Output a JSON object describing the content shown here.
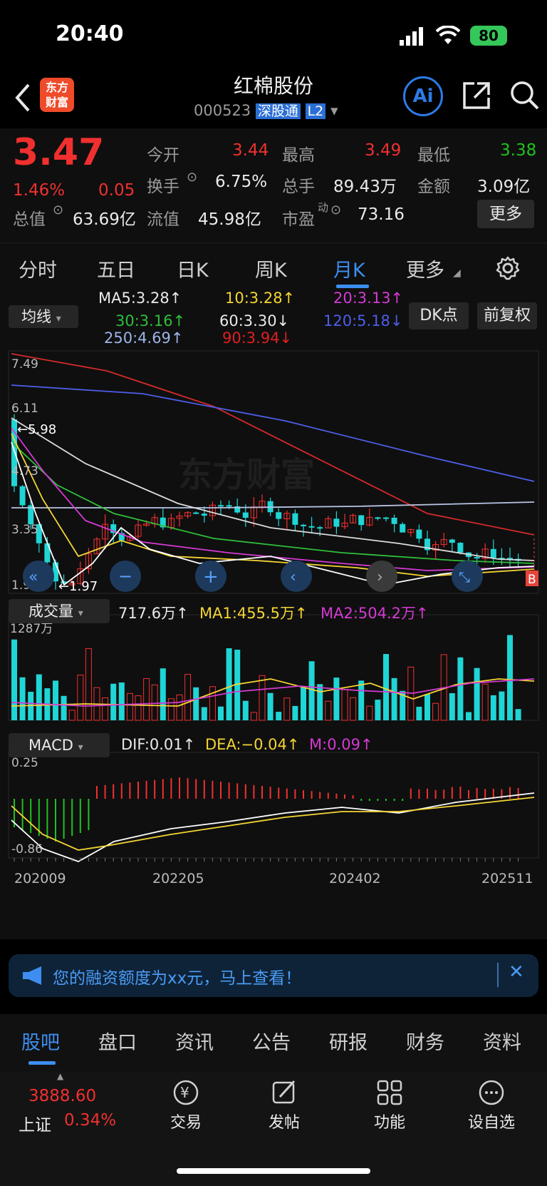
{
  "status_bar": {
    "time": "20:40",
    "battery": "80"
  },
  "header": {
    "title": "红棉股份",
    "code": "000523",
    "badge_market": "深股通",
    "badge_level": "L2",
    "ai_label": "Ai"
  },
  "quote": {
    "price": "3.47",
    "change_pct": "1.46%",
    "change": "0.05",
    "open_label": "今开",
    "open": "3.44",
    "high_label": "最高",
    "high": "3.49",
    "low_label": "最低",
    "low": "3.38",
    "turnover_label": "换手",
    "turnover": "6.75%",
    "volume_label": "总手",
    "volume": "89.43万",
    "amount_label": "金额",
    "amount": "3.09亿",
    "mcap_label": "总值",
    "mcap": "63.69亿",
    "float_label": "流值",
    "float": "45.98亿",
    "pe_label": "市盈",
    "pe_sup": "动",
    "pe": "73.16",
    "more_button": "更多"
  },
  "tabs": [
    "分时",
    "五日",
    "日K",
    "周K",
    "月K",
    "更多"
  ],
  "active_tab": "月K",
  "indicators": {
    "ma_selector": "均线",
    "ma5": "MA5:3.28↑",
    "ma10": "10:3.28↑",
    "ma20": "20:3.13↑",
    "ma30": "30:3.16↑",
    "ma60": "60:3.30↓",
    "ma120": "120:5.18↓",
    "ma250": "250:4.69↑",
    "ma90": "90:3.94↓",
    "dk_button": "DK点",
    "adjust_button": "前复权"
  },
  "kline": {
    "y_labels": [
      "7.49",
      "6.11",
      "4.73",
      "3.35",
      "1.97"
    ],
    "high_mark": "←5.98",
    "low_mark": "←1.97",
    "b_marker": "B",
    "watermark": "东方财富"
  },
  "volume": {
    "selector": "成交量",
    "value": "717.6万↑",
    "ma1": "MA1:455.5万↑",
    "ma2": "MA2:504.2万↑",
    "y_label": "1287万"
  },
  "macd": {
    "selector": "MACD",
    "dif": "DIF:0.01↑",
    "dea": "DEA:−0.04↑",
    "m": "M:0.09↑",
    "y_top": "0.25",
    "y_bottom": "-0.86"
  },
  "x_axis": [
    "202009",
    "202205",
    "202402",
    "202511"
  ],
  "banner": {
    "text": "您的融资额度为xx元，马上查看！"
  },
  "bottom_tabs": [
    "股吧",
    "盘口",
    "资讯",
    "公告",
    "研报",
    "财务",
    "资料"
  ],
  "bottom_tab_active": "股吧",
  "bottom_bar": {
    "index_value": "3888.60",
    "index_name": "上证",
    "index_pct": "0.34%",
    "trade": "交易",
    "post": "发帖",
    "function": "功能",
    "watchlist": "设自选"
  },
  "colors": {
    "up": "#f0302f",
    "down": "#1ec31e",
    "accent": "#3d8ef0",
    "teal": "#20d5d5"
  }
}
